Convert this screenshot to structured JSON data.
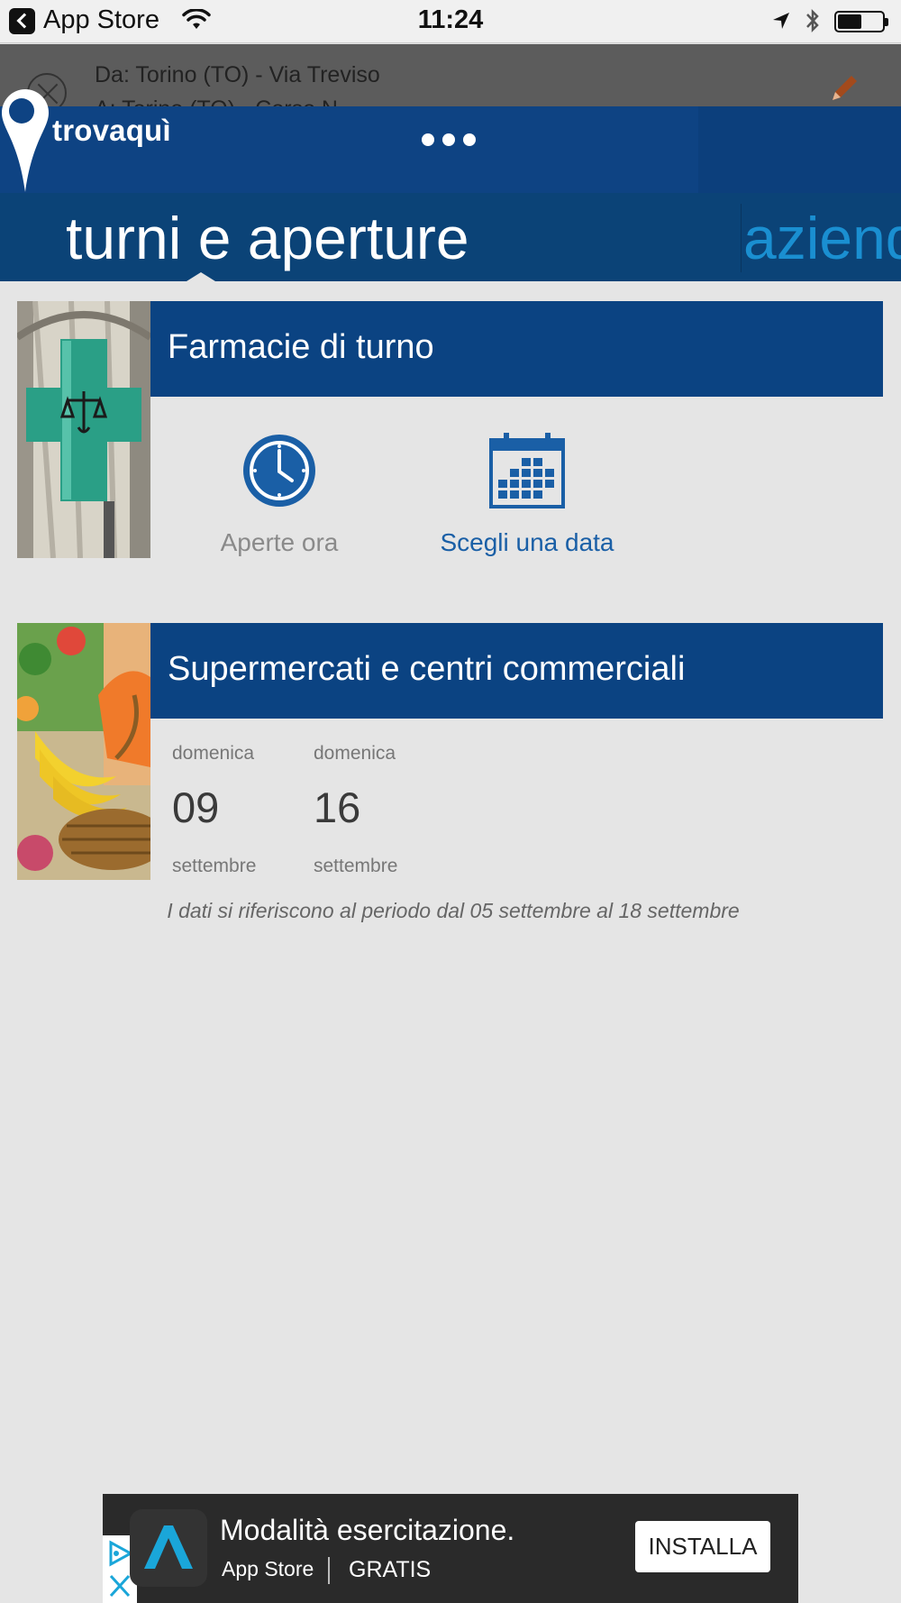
{
  "status_bar": {
    "back_app": "App Store",
    "time": "11:24"
  },
  "route": {
    "from": "Da:  Torino (TO) - Via Treviso",
    "to": "A:  Torino (TO) - Corso N..."
  },
  "header": {
    "brand": "trovaquì"
  },
  "tabs": {
    "active": "turni e aperture",
    "next": "aziende"
  },
  "pharmacy": {
    "title": "Farmacie di turno",
    "open_now_label": "Aperte ora",
    "choose_date_label": "Scegli una data"
  },
  "supermarkets": {
    "title": "Supermercati e centri commerciali",
    "dates": [
      {
        "weekday": "domenica",
        "day": "09",
        "month": "settembre"
      },
      {
        "weekday": "domenica",
        "day": "16",
        "month": "settembre"
      }
    ],
    "note": "I dati si riferiscono al periodo dal 05 settembre al 18 settembre"
  },
  "ad": {
    "title": "Modalità esercitazione.",
    "store": "App Store",
    "price": "GRATIS",
    "install_label": "INSTALLA"
  },
  "colors": {
    "header_blue": "#0e4383",
    "link_blue": "#1a5fa6",
    "tab_next": "#1a8fd1"
  }
}
